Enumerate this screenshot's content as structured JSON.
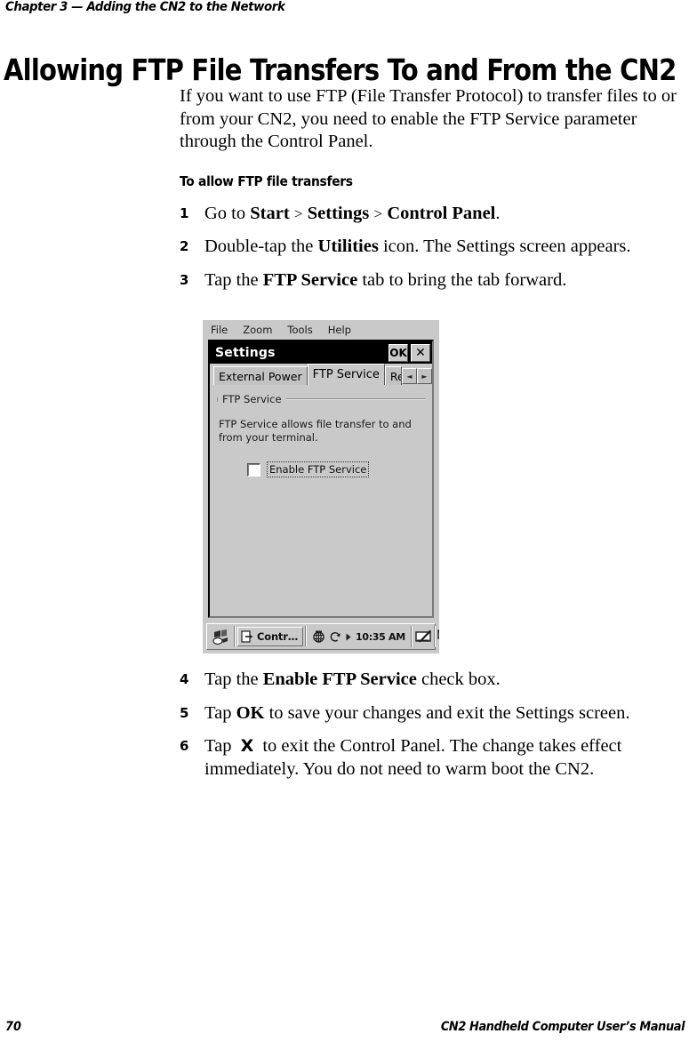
{
  "header": {
    "running_head": "Chapter 3 — Adding the CN2 to the Network"
  },
  "title": "Allowing FTP File Transfers To and From the CN2",
  "intro": "If you want to use FTP (File Transfer Protocol) to transfer files to or from your CN2, you need to enable the FTP Service parameter through the Control Panel.",
  "subhead": "To allow FTP file transfers",
  "steps": [
    {
      "num": "1",
      "parts": [
        {
          "t": "Go to ",
          "b": false
        },
        {
          "t": "Start",
          "b": true
        },
        {
          "t": " > ",
          "b": false,
          "gt": true
        },
        {
          "t": "Settings",
          "b": true
        },
        {
          "t": " > ",
          "b": false,
          "gt": true
        },
        {
          "t": "Control Panel",
          "b": true
        },
        {
          "t": ".",
          "b": false
        }
      ]
    },
    {
      "num": "2",
      "parts": [
        {
          "t": "Double-tap the ",
          "b": false
        },
        {
          "t": "Utilities",
          "b": true
        },
        {
          "t": " icon. The Settings screen appears.",
          "b": false
        }
      ]
    },
    {
      "num": "3",
      "parts": [
        {
          "t": "Tap the ",
          "b": false
        },
        {
          "t": "FTP Service",
          "b": true
        },
        {
          "t": " tab to bring the tab forward.",
          "b": false
        }
      ]
    },
    {
      "num": "4",
      "parts": [
        {
          "t": "Tap the ",
          "b": false
        },
        {
          "t": "Enable FTP Service",
          "b": true
        },
        {
          "t": " check box.",
          "b": false
        }
      ]
    },
    {
      "num": "5",
      "parts": [
        {
          "t": "Tap ",
          "b": false
        },
        {
          "t": "OK",
          "b": true
        },
        {
          "t": " to save your changes and exit the Settings screen.",
          "b": false
        }
      ]
    },
    {
      "num": "6",
      "parts": [
        {
          "t": "Tap ",
          "b": false
        },
        {
          "t": "X",
          "b": false,
          "x": true
        },
        {
          "t": " to exit the Control Panel. The change takes effect immediately. You do not need to warm boot the CN2.",
          "b": false
        }
      ]
    }
  ],
  "device_screenshot": {
    "menubar": [
      "File",
      "Zoom",
      "Tools",
      "Help"
    ],
    "window_title": "Settings",
    "title_buttons": [
      {
        "name": "ok-button",
        "label": "OK"
      },
      {
        "name": "close-button",
        "label": "✕"
      }
    ],
    "tabs": [
      {
        "label": "External Power",
        "active": false
      },
      {
        "label": "FTP Service",
        "active": true
      },
      {
        "label": "Regi",
        "active": false,
        "clipped": true
      }
    ],
    "tab_nav": [
      {
        "name": "tab-scroll-left-icon",
        "glyph": "◄"
      },
      {
        "name": "tab-scroll-right-icon",
        "glyph": "►"
      }
    ],
    "group_label": "FTP Service",
    "description": "FTP Service allows file transfer to and from your terminal.",
    "checkbox": {
      "label": "Enable FTP Service",
      "checked": false
    },
    "taskbar": {
      "start_icon": "start-flag-icon",
      "task_label": "Contr…",
      "task_icon": "control-panel-icon",
      "tray_icons": [
        "network-globe-icon",
        "connection-sync-icon",
        "play-arrow-icon"
      ],
      "clock": "10:35 AM",
      "right_icons": [
        "stylus-input-icon",
        "switch-window-icon"
      ]
    }
  },
  "footer": {
    "page_number": "70",
    "manual_title": "CN2 Handheld Computer User’s Manual"
  },
  "colors": {
    "page_bg": "#ffffff",
    "text": "#000000",
    "device_face": "#c9c9c9",
    "titlebar": "#000000",
    "titlebar_text": "#ffffff"
  }
}
